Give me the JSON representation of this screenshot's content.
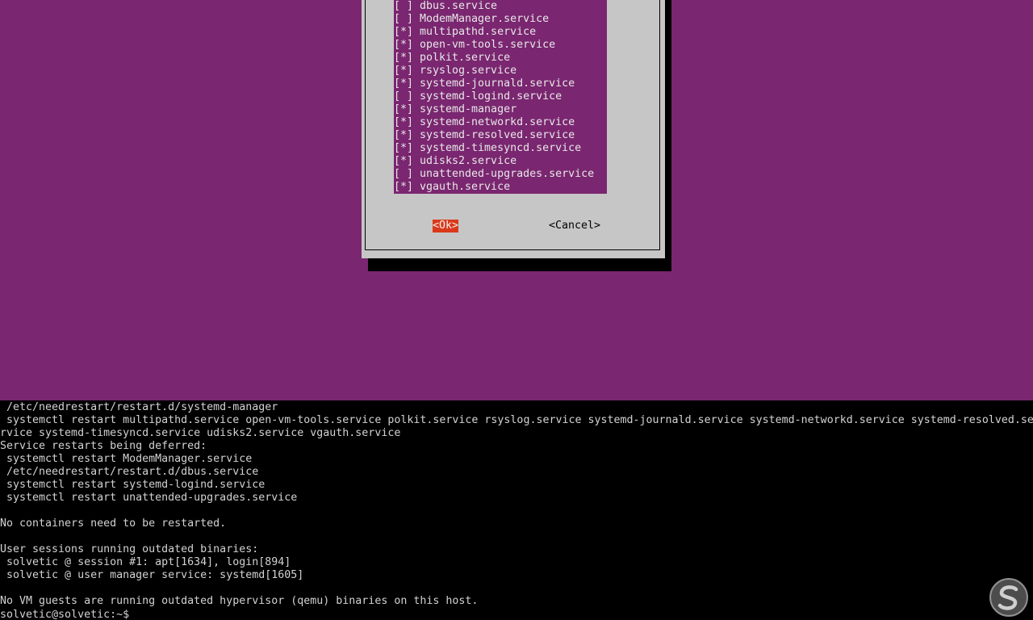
{
  "dialog": {
    "services": [
      {
        "checked": false,
        "mark": "[ ]",
        "name": "dbus.service"
      },
      {
        "checked": false,
        "mark": "[ ]",
        "name": "ModemManager.service"
      },
      {
        "checked": true,
        "mark": "[*]",
        "name": "multipathd.service"
      },
      {
        "checked": true,
        "mark": "[*]",
        "name": "open-vm-tools.service"
      },
      {
        "checked": true,
        "mark": "[*]",
        "name": "polkit.service"
      },
      {
        "checked": true,
        "mark": "[*]",
        "name": "rsyslog.service"
      },
      {
        "checked": true,
        "mark": "[*]",
        "name": "systemd-journald.service"
      },
      {
        "checked": false,
        "mark": "[ ]",
        "name": "systemd-logind.service"
      },
      {
        "checked": true,
        "mark": "[*]",
        "name": "systemd-manager"
      },
      {
        "checked": true,
        "mark": "[*]",
        "name": "systemd-networkd.service"
      },
      {
        "checked": true,
        "mark": "[*]",
        "name": "systemd-resolved.service"
      },
      {
        "checked": true,
        "mark": "[*]",
        "name": "systemd-timesyncd.service"
      },
      {
        "checked": true,
        "mark": "[*]",
        "name": "udisks2.service"
      },
      {
        "checked": false,
        "mark": "[ ]",
        "name": "unattended-upgrades.service"
      },
      {
        "checked": true,
        "mark": "[*]",
        "name": "vgauth.service"
      }
    ],
    "ok_label": "<Ok>",
    "cancel_label": "<Cancel>"
  },
  "terminal": {
    "lines": [
      " /etc/needrestart/restart.d/systemd-manager",
      " systemctl restart multipathd.service open-vm-tools.service polkit.service rsyslog.service systemd-journald.service systemd-networkd.service systemd-resolved.se",
      "rvice systemd-timesyncd.service udisks2.service vgauth.service",
      "Service restarts being deferred:",
      " systemctl restart ModemManager.service",
      " /etc/needrestart/restart.d/dbus.service",
      " systemctl restart systemd-logind.service",
      " systemctl restart unattended-upgrades.service",
      "",
      "No containers need to be restarted.",
      "",
      "User sessions running outdated binaries:",
      " solvetic @ session #1: apt[1634], login[894]",
      " solvetic @ user manager service: systemd[1605]",
      "",
      "No VM guests are running outdated hypervisor (qemu) binaries on this host."
    ],
    "prompt": "solvetic@solvetic:~$ "
  },
  "watermark": {
    "icon": "solvetic-s-logo-icon"
  },
  "colors": {
    "background_purple": "#7a2670",
    "dialog_gray": "#c6c6c6",
    "ok_red": "#d9391a",
    "terminal_black": "#000000",
    "terminal_text": "#d2d2d2"
  }
}
